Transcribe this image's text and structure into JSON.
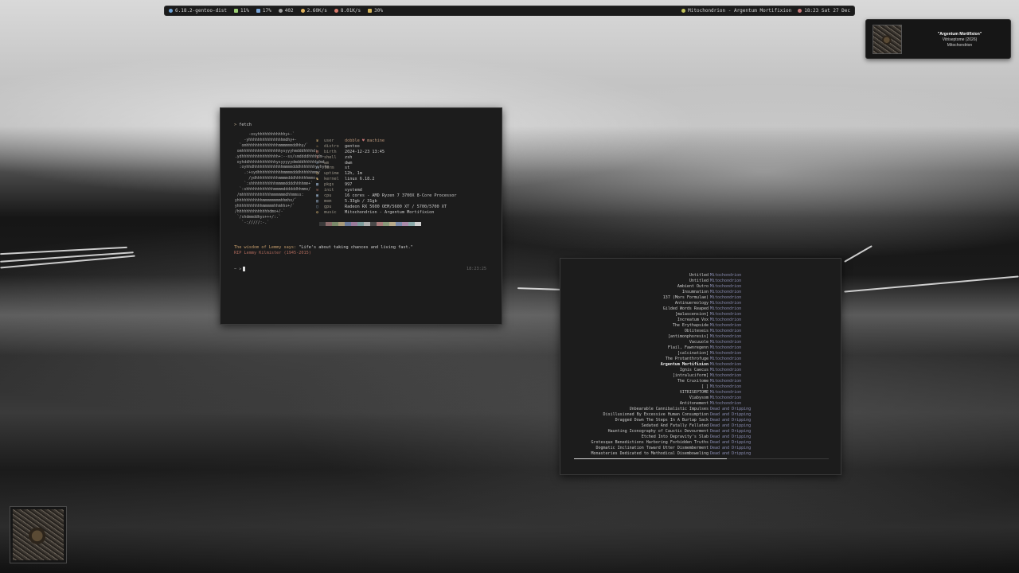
{
  "topbar": {
    "os": "6.18.2-gentoo-dist",
    "cpu": "11%",
    "mem": "17%",
    "pkgs": "402",
    "net_down": "2.60K/s",
    "net_up": "8.01K/s",
    "volume": "30%",
    "now_playing": "Mitochondrion - Argentum Mortifixion",
    "clock": "18:23 Sat 27 Dec",
    "colors": {
      "os": "#6fa3d6",
      "cpu": "#9ccf74",
      "mem": "#7aa5d8",
      "pkgs": "#9f9f9f",
      "net_down": "#e0b25c",
      "net_up": "#d87a6c",
      "volume": "#d4b45c",
      "now_playing": "#c2c25a",
      "clock": "#c87a7a"
    }
  },
  "notification": {
    "title": "\"Argentum Mortifixion\"",
    "album": "Vitriseptome (2026)",
    "artist": "Mitochondrion"
  },
  "terminal": {
    "prompt_arrow": ">",
    "command": "fetch",
    "ascii_logo": "       -osyhhhhhhhhhhhhy+-`\n     -yhhhhhhhhhhhhhhhmdhy+-\n   `omhhhhhhhhhhhhhhmmmmmmddhhy/`\n  omhhhhhhhhhhhhhhhhhysyyyhmdddhhhhd:\n .ydhhhhhhhhhhhhhhhh+:--ss/smddddhhhhdm-\n  oyhddhhhhhhhhhhhhysyyyyydmdddhhhhhhdmd\n   :oyhhdhhhhhhhhhhhhhmmmmdddhhhhhhhyyhyhm\n     .:+sydhhhhhhhhhhhmmmmdddhhhhhhmmy\n       /ydhhhhhhhhhhmmmmdddhhhhhhmmo-\n     `:shhhhhhhhhhhmmmmddddhhhhmm+`\n   `:shhhhhhhhhhhhmmmmddddddhhmmo/\n  /mhhhhhhhhhhhhhmmmmmmdhhmmss:\n yhhhhhhhhhhhmmmmmmmmhhmho/`\n yhhhhhhhhhhhmmmmmhhmhhs+/`\n /hhhhhhhhhhhhhhdmo+/-`\n  `/shdmmddhys+++/:.`\n    `-://///:-.`",
    "info": [
      {
        "icon": "♛",
        "icon_color": "#c9a96e",
        "key": "user",
        "value_pre": "dobble ",
        "heart": "♥",
        "value_post": " machine",
        "value_color": "#b89478"
      },
      {
        "icon": "♨",
        "icon_color": "#c9a96e",
        "key": "distro",
        "value": "gentoo",
        "value_color": "#c8c8c8"
      },
      {
        "icon": "▤",
        "icon_color": "#b87a6a",
        "key": "birth",
        "value": "2024-12-23 13:45",
        "value_color": "#c8c8c8"
      },
      {
        "icon": "$",
        "icon_color": "#a86a62",
        "key": "shell",
        "value": "zsh",
        "value_color": "#c8c8c8"
      },
      {
        "icon": "▭",
        "icon_color": "#8aa0b8",
        "key": "wm",
        "value": "dwm",
        "value_color": "#c8c8c8"
      },
      {
        "icon": ">_",
        "icon_color": "#8aa0b8",
        "key": "term",
        "value": "st",
        "value_color": "#c8c8c8"
      },
      {
        "icon": "◷",
        "icon_color": "#c9a96e",
        "key": "uptime",
        "value": "12h, 1m",
        "value_color": "#c8c8c8"
      },
      {
        "icon": "♞",
        "icon_color": "#c9a96e",
        "key": "kernel",
        "value": "linux 6.18.2",
        "value_color": "#c8c8c8"
      },
      {
        "icon": "▦",
        "icon_color": "#8aa0b8",
        "key": "pkgs",
        "value": "997",
        "value_color": "#c8c8c8"
      },
      {
        "icon": "⚒",
        "icon_color": "#b87a6a",
        "key": "init",
        "value": "systemd",
        "value_color": "#c8c8c8"
      },
      {
        "icon": "▣",
        "icon_color": "#8aa0b8",
        "key": "cpu",
        "value": "16 cores - AMD Ryzen 7 3700X 8-Core Processor",
        "value_color": "#c8c8c8"
      },
      {
        "icon": "▥",
        "icon_color": "#8aa0b8",
        "key": "mem",
        "value": "5.33gb / 31gb",
        "value_color": "#c8c8c8"
      },
      {
        "icon": "▢",
        "icon_color": "#8aa0b8",
        "key": "gpu",
        "value": "Radeon RX 5600 OEM/5600 XT / 5700/5700 XT",
        "value_color": "#c8c8c8"
      },
      {
        "icon": "✪",
        "icon_color": "#c9a96e",
        "key": "music",
        "value": "Mitochondrion - Argentum Mortifixion",
        "value_color": "#c8c8c8"
      }
    ],
    "palette": [
      "#3a3a3a",
      "#8a6a6a",
      "#7a8a6a",
      "#a89a7a",
      "#6a7a9a",
      "#9a7a9a",
      "#7a9a9a",
      "#b0b0b0",
      "#4a4a4a",
      "#a87a7a",
      "#8a9a7a",
      "#b8aa8a",
      "#7a8aaa",
      "#aa8aaa",
      "#8aaaaa",
      "#d0d0d0"
    ],
    "quote_prefix": "The wisdom of Lemmy says:",
    "quote_text": " \"Life's about taking chances and living fast.\"",
    "rip_line": "RIP Lemmy Kilmister (1945-2015)",
    "prompt2": "~ >",
    "time": "18:23:25"
  },
  "music_list": {
    "tracks": [
      {
        "name": "Untitled",
        "artist": "Mitochondrion"
      },
      {
        "name": "Untitled",
        "artist": "Mitochondrion"
      },
      {
        "name": "Ambient Outro",
        "artist": "Mitochondrion"
      },
      {
        "name": "Insumnation",
        "artist": "Mitochondrion"
      },
      {
        "name": "137 (Mors Formulae)",
        "artist": "Mitochondrion"
      },
      {
        "name": "Antinuereology",
        "artist": "Mitochondrion"
      },
      {
        "name": "Gilded Words Reaped",
        "artist": "Mitochondrion"
      },
      {
        "name": "[malascension]",
        "artist": "Mitochondrion"
      },
      {
        "name": "Increatum Vox",
        "artist": "Mitochondrion"
      },
      {
        "name": "The Erythapside",
        "artist": "Mitochondrion"
      },
      {
        "name": "Obliteseis",
        "artist": "Mitochondrion"
      },
      {
        "name": "[antimonphoresis]",
        "artist": "Mitochondrion"
      },
      {
        "name": "Vacuuole",
        "artist": "Mitochondrion"
      },
      {
        "name": "Flail, Fawnregenn",
        "artist": "Mitochondrion"
      },
      {
        "name": "[calcination]",
        "artist": "Mitochondrion"
      },
      {
        "name": "The Protanthrofuge",
        "artist": "Mitochondrion"
      },
      {
        "name": "Argentum Mortifixion",
        "artist": "Mitochondrion",
        "selected": true
      },
      {
        "name": "Ignis Caecus",
        "artist": "Mitochondrion"
      },
      {
        "name": "[intraluciform]",
        "artist": "Mitochondrion"
      },
      {
        "name": "The Cruxitome",
        "artist": "Mitochondrion"
      },
      {
        "name": "[ ]",
        "artist": "Mitochondrion"
      },
      {
        "name": "VITRISEPTOME",
        "artist": "Mitochondrion"
      },
      {
        "name": "Viabysom",
        "artist": "Mitochondrion"
      },
      {
        "name": "Antitonement",
        "artist": "Mitochondrion"
      },
      {
        "name": "Unbearable Cannibalistic Impulses",
        "artist": "Dead and Dripping"
      },
      {
        "name": "Disillusioned By Excessive Human Consumption",
        "artist": "Dead and Dripping"
      },
      {
        "name": "Dragged Down The Steps In A Burlap Sack",
        "artist": "Dead and Dripping"
      },
      {
        "name": "Sedated And Fatally Fellated",
        "artist": "Dead and Dripping"
      },
      {
        "name": "Haunting Iconography of Caustic Devourment",
        "artist": "Dead and Dripping"
      },
      {
        "name": "Etched Into Depravity's Slab",
        "artist": "Dead and Dripping"
      },
      {
        "name": "Grotesque Benedictions Harboring Forbidden Truths",
        "artist": "Dead and Dripping"
      },
      {
        "name": "Dogmatic Inclination Toward Utter Dismemberment",
        "artist": "Dead and Dripping"
      },
      {
        "name": "Monasteries Dedicated to Methodical Disemboweling",
        "artist": "Dead and Dripping"
      }
    ],
    "progress": 0.6
  }
}
